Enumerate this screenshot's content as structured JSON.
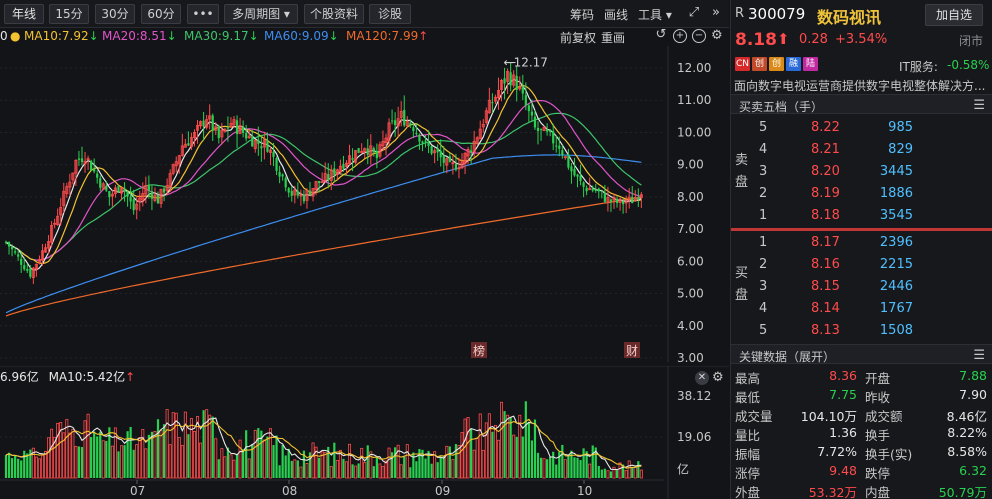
{
  "toolbar": {
    "buttons": [
      "年线",
      "15分",
      "30分",
      "60分",
      "•••",
      "多周期图 ▾",
      "个股资料",
      "诊股"
    ],
    "right_tools": [
      "筹码",
      "画线",
      "工具 ▾"
    ]
  },
  "ma_row": {
    "ma_partial": "0",
    "ma10": "MA10:7.92",
    "ma20": "MA20:8.51",
    "ma30": "MA30:9.17",
    "ma60": "MA60:9.09",
    "ma120": "MA120:7.99",
    "fuquan": "前复权",
    "chonghua": "重画"
  },
  "price_axis": {
    "ticks": [
      "12.00",
      "11.00",
      "10.00",
      "9.00",
      "8.00",
      "7.00",
      "6.00",
      "5.00",
      "4.00",
      "3.00"
    ],
    "peak_label": "12.17",
    "marker_bang": "榜",
    "marker_cai": "财"
  },
  "volume": {
    "legend_vol": "6.96亿",
    "legend_ma10": "MA10:5.42亿",
    "axis_ticks": [
      "38.12",
      "19.06",
      "亿"
    ],
    "x_labels": [
      "07",
      "08",
      "09",
      "10"
    ]
  },
  "stock": {
    "prefix": "R",
    "code": "300079",
    "name": "数码视讯",
    "add_button": "加自选",
    "price": "8.18",
    "change": "0.28",
    "change_pct": "+3.54%",
    "market_status": "闭市",
    "flags": [
      "CN",
      "创",
      "融",
      "陆"
    ],
    "sector_label": "IT服务:",
    "sector_change": "-0.58%",
    "description": "面向数字电视运营商提供数字电视整体解决方..."
  },
  "orderbook": {
    "title": "买卖五档（手）",
    "sell_label": [
      "卖",
      "盘"
    ],
    "buy_label": [
      "买",
      "盘"
    ],
    "asks": [
      {
        "level": "5",
        "price": "8.22",
        "volume": "985"
      },
      {
        "level": "4",
        "price": "8.21",
        "volume": "829"
      },
      {
        "level": "3",
        "price": "8.20",
        "volume": "3445"
      },
      {
        "level": "2",
        "price": "8.19",
        "volume": "1886"
      },
      {
        "level": "1",
        "price": "8.18",
        "volume": "3545"
      }
    ],
    "bids": [
      {
        "level": "1",
        "price": "8.17",
        "volume": "2396"
      },
      {
        "level": "2",
        "price": "8.16",
        "volume": "2215"
      },
      {
        "level": "3",
        "price": "8.15",
        "volume": "2446"
      },
      {
        "level": "4",
        "price": "8.14",
        "volume": "1767"
      },
      {
        "level": "5",
        "price": "8.13",
        "volume": "1508"
      }
    ]
  },
  "key_data": {
    "title": "关键数据（展开）",
    "rows": [
      {
        "l": "最高",
        "lv": "8.36",
        "lc": "red",
        "r": "开盘",
        "rv": "7.88",
        "rc": "green"
      },
      {
        "l": "最低",
        "lv": "7.75",
        "lc": "green",
        "r": "昨收",
        "rv": "7.90",
        "rc": "white"
      },
      {
        "l": "成交量",
        "lv": "104.10万",
        "lc": "white",
        "r": "成交额",
        "rv": "8.46亿",
        "rc": "white"
      },
      {
        "l": "量比",
        "lv": "1.36",
        "lc": "white",
        "r": "换手",
        "rv": "8.22%",
        "rc": "white"
      },
      {
        "l": "振幅",
        "lv": "7.72%",
        "lc": "white",
        "r": "换手(实)",
        "rv": "8.58%",
        "rc": "white"
      },
      {
        "l": "涨停",
        "lv": "9.48",
        "lc": "red",
        "r": "跌停",
        "rv": "6.32",
        "rc": "green"
      },
      {
        "l": "外盘",
        "lv": "53.32万",
        "lc": "red",
        "r": "内盘",
        "rv": "50.79万",
        "rc": "green"
      }
    ]
  },
  "colors": {
    "up": "#ff4b4b",
    "down": "#28d14f",
    "ma5": "#e8e8e8",
    "ma10": "#f2c230",
    "ma20": "#e055c8",
    "ma30": "#3ec46a",
    "ma60": "#3d8ef0",
    "ma120": "#f06a2a"
  }
}
